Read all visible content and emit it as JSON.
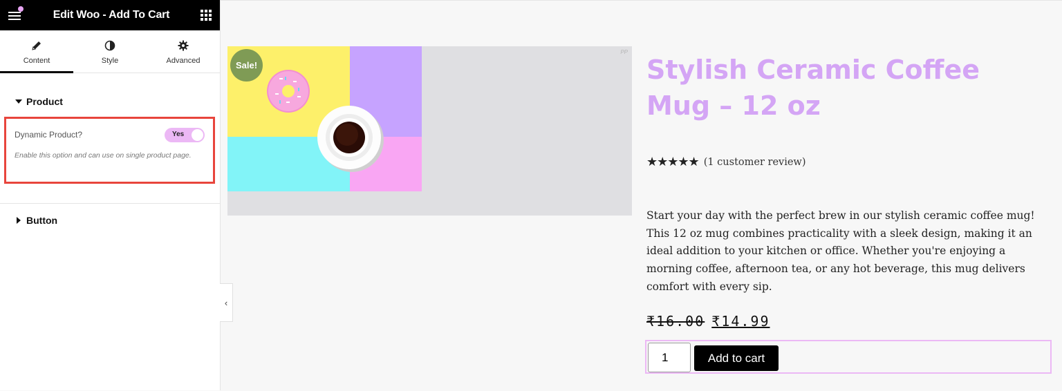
{
  "sidebar": {
    "title": "Edit Woo - Add To Cart",
    "tabs": [
      {
        "label": "Content",
        "icon": "pencil-icon"
      },
      {
        "label": "Style",
        "icon": "contrast-icon"
      },
      {
        "label": "Advanced",
        "icon": "gear-icon"
      }
    ],
    "sections": {
      "product": "Product",
      "button": "Button"
    },
    "control": {
      "label": "Dynamic Product?",
      "toggle_value": "Yes",
      "description": "Enable this option and can use on single product page."
    }
  },
  "product": {
    "badge": "Sale!",
    "watermark": "PP",
    "title": "Stylish Ceramic Coffee Mug – 12 oz",
    "stars": "★★★★★",
    "rating": 5,
    "review_link": "(1 customer review)",
    "description": "Start your day with the perfect brew in our stylish ceramic coffee mug! This 12 oz mug combines practicality with a sleek design, making it an ideal addition to your kitchen or office. Whether you're enjoying a morning coffee, afternoon tea, or any hot beverage, this mug delivers comfort with every sip.",
    "old_price": "₹16.00",
    "price": "₹14.99",
    "quantity": "1",
    "add_to_cart": "Add to cart"
  },
  "colors": {
    "accent": "#d4a5f5",
    "highlight_border": "#e8453c",
    "sale_badge": "#7f9b55",
    "image_yellow": "#fdf06a",
    "image_purple": "#c6a3ff",
    "image_cyan": "#82f4f8",
    "image_pink": "#f9a6f3"
  }
}
